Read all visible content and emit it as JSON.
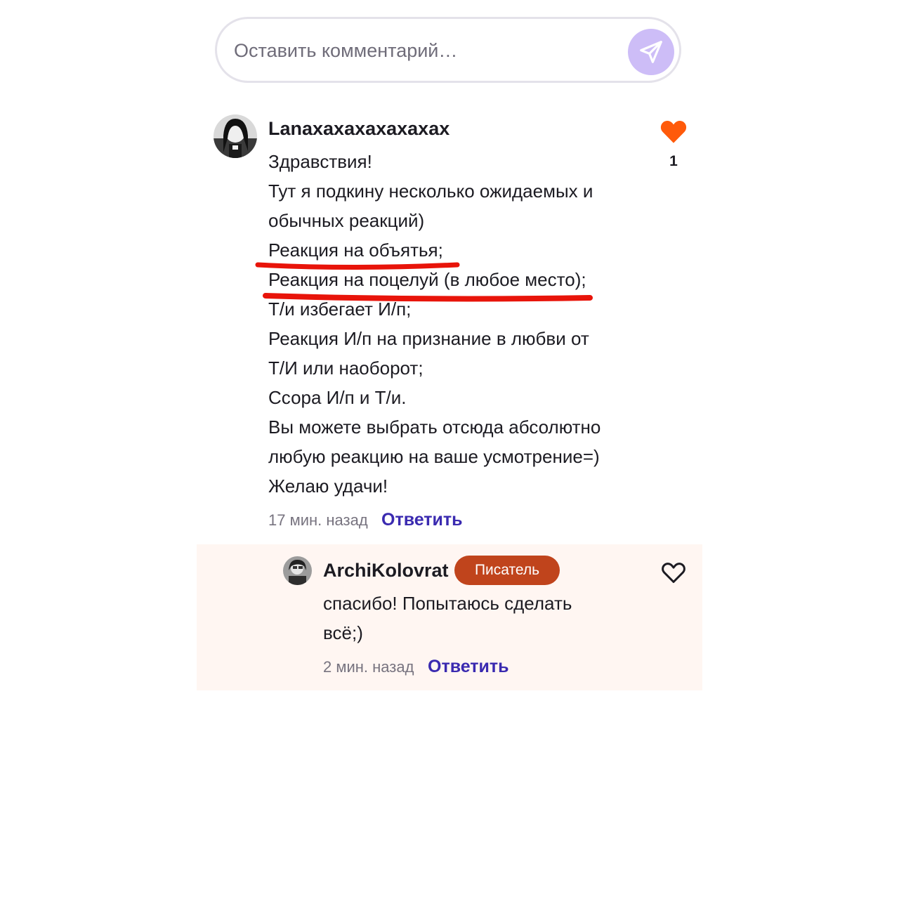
{
  "comment_input": {
    "placeholder": "Оставить комментарий…",
    "send_icon": "send-paper-plane-icon",
    "accent": "#cdbdf7"
  },
  "comment": {
    "username": "Lanaxaxaxaxaxaxax",
    "lines": [
      "Здравствия!",
      "Тут я подкину несколько ожидаемых и",
      "обычных реакций)",
      "Реакция на объятья;",
      "Реакция на поцелуй (в любое место);",
      "Т/и избегает И/п;",
      "Реакция И/п на признание в любви от",
      "Т/И или наоборот;",
      "Ссора И/п и Т/и.",
      "Вы можете выбрать отсюда абсолютно",
      "любую реакцию на ваше усмотрение=)",
      "Желаю удачи!"
    ],
    "time": "17 мин. назад",
    "reply_label": "Ответить",
    "likes": "1",
    "like_color": "#ff5a0a",
    "underlined_lines": [
      "Реакция на объятья;",
      "Реакция на поцелуй (в любое место);"
    ],
    "underline_color": "#e8140a"
  },
  "reply": {
    "username": "ArchiKolovrat",
    "badge": "Писатель",
    "badge_color": "#c0441c",
    "lines": [
      "спасибо! Попытаюсь сделать",
      "всё;)"
    ],
    "time": "2 мин. назад",
    "reply_label": "Ответить",
    "background": "#fff6f2"
  }
}
